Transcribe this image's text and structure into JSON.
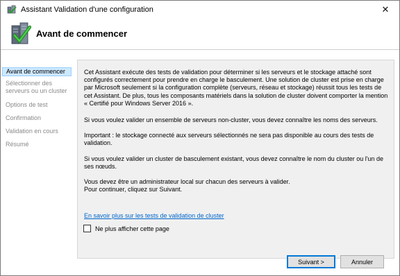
{
  "window": {
    "title": "Assistant Validation d'une configuration",
    "close_glyph": "✕"
  },
  "header": {
    "title": "Avant de commencer"
  },
  "sidebar": {
    "items": [
      {
        "label": "Avant de commencer",
        "active": true
      },
      {
        "label": "Sélectionner des serveurs ou un cluster",
        "active": false
      },
      {
        "label": "Options de test",
        "active": false
      },
      {
        "label": "Confirmation",
        "active": false
      },
      {
        "label": "Validation en cours",
        "active": false
      },
      {
        "label": "Résumé",
        "active": false
      }
    ]
  },
  "content": {
    "paragraphs": [
      "Cet Assistant exécute des tests de validation pour déterminer si les serveurs et le stockage attaché sont configurés correctement pour prendre en charge le basculement. Une solution de cluster est prise en charge par Microsoft seulement si la configuration complète (serveurs, réseau et stockage) réussit tous les tests de cet Assistant. De plus, tous les composants matériels dans la solution de cluster doivent comporter la mention « Certifié pour Windows Server 2016 ».",
      "Si vous voulez valider un ensemble de serveurs non-cluster, vous devez connaître les noms des serveurs.",
      "Important : le stockage connecté aux serveurs sélectionnés ne sera pas disponible au cours des tests de validation.",
      "Si vous voulez valider un cluster de basculement existant, vous devez connaître le nom du cluster ou l'un de ses nœuds.",
      "Vous devez être un administrateur local sur chacun des serveurs à valider.",
      "Pour continuer, cliquez sur Suivant."
    ],
    "link": "En savoir plus sur les tests de validation de cluster",
    "checkbox_label": "Ne plus afficher cette page",
    "checkbox_checked": false
  },
  "buttons": {
    "next": "Suivant >",
    "cancel": "Annuler"
  },
  "icons": {
    "app": "cluster-validation-icon",
    "header": "server-checkmark-icon"
  },
  "colors": {
    "accent": "#0078d7",
    "selected_bg": "#cde8ff",
    "link": "#0066cc"
  }
}
